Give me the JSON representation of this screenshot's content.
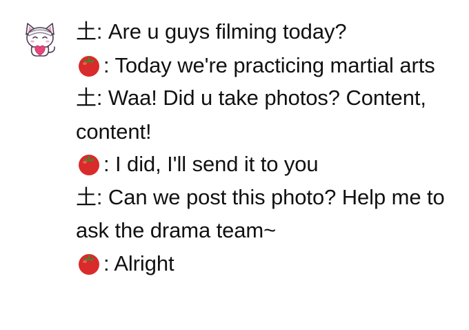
{
  "avatar": {
    "icon": "cat-avatar-icon",
    "heart_text": "",
    "band_text": ""
  },
  "colors": {
    "tomato_red": "#d92b2b",
    "tomato_leaf": "#3c8b2d",
    "text": "#111111"
  },
  "messages": [
    {
      "speaker_type": "text",
      "speaker": "土",
      "text": ": Are u guys filming today?"
    },
    {
      "speaker_type": "icon",
      "speaker_icon": "tomato-icon",
      "text": ": Today we're practicing martial arts"
    },
    {
      "speaker_type": "text",
      "speaker": "土",
      "text": ": Waa! Did u take photos? Content, content!"
    },
    {
      "speaker_type": "icon",
      "speaker_icon": "tomato-icon",
      "text": ": I did, I'll send it to you"
    },
    {
      "speaker_type": "text",
      "speaker": "土",
      "text": ": Can we post this photo? Help me to ask the drama team~"
    },
    {
      "speaker_type": "icon",
      "speaker_icon": "tomato-icon",
      "text": ": Alright"
    }
  ]
}
